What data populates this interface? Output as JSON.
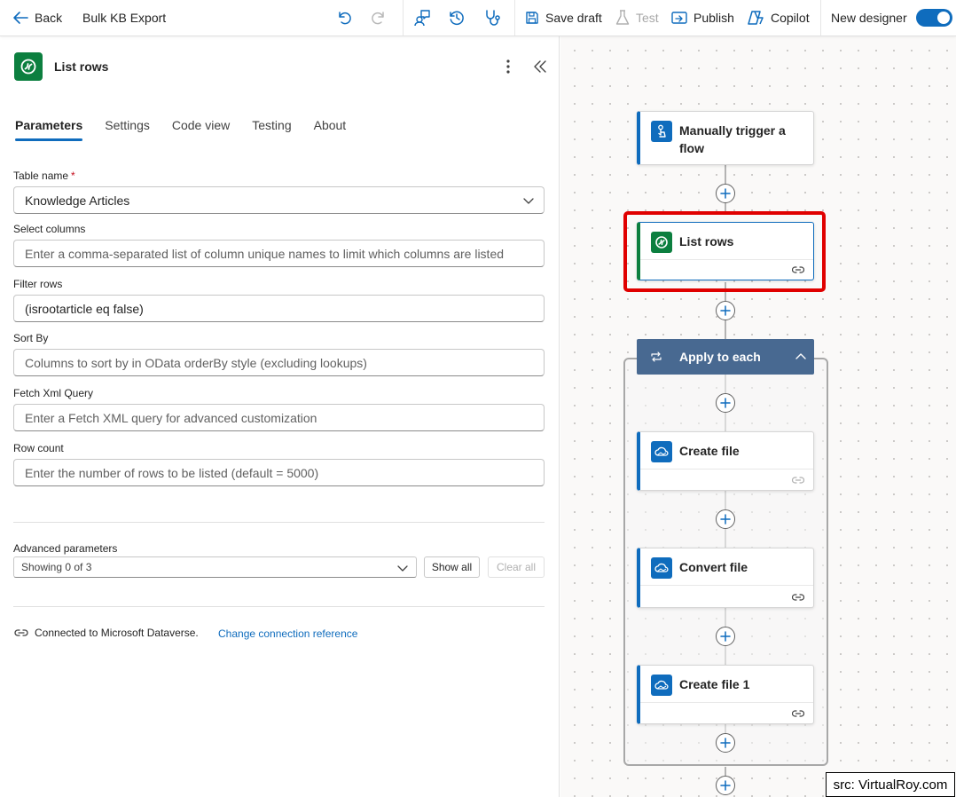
{
  "toolbar": {
    "back_label": "Back",
    "flow_name": "Bulk KB Export",
    "save_draft_label": "Save draft",
    "test_label": "Test",
    "publish_label": "Publish",
    "copilot_label": "Copilot",
    "new_designer_label": "New designer",
    "new_designer_on": true
  },
  "panel": {
    "title": "List rows",
    "tabs": [
      "Parameters",
      "Settings",
      "Code view",
      "Testing",
      "About"
    ],
    "active_tab": "Parameters",
    "fields": {
      "table_name": {
        "label": "Table name",
        "required_mark": "*",
        "value": "Knowledge Articles"
      },
      "select_columns": {
        "label": "Select columns",
        "placeholder": "Enter a comma-separated list of column unique names to limit which columns are listed"
      },
      "filter_rows": {
        "label": "Filter rows",
        "value": "(isrootarticle eq false)"
      },
      "sort_by": {
        "label": "Sort By",
        "placeholder": "Columns to sort by in OData orderBy style (excluding lookups)"
      },
      "fetch_xml": {
        "label": "Fetch Xml Query",
        "placeholder": "Enter a Fetch XML query for advanced customization"
      },
      "row_count": {
        "label": "Row count",
        "placeholder": "Enter the number of rows to be listed (default = 5000)"
      }
    },
    "advanced": {
      "label": "Advanced parameters",
      "selected": "Showing 0 of 3",
      "show_all_label": "Show all",
      "clear_all_label": "Clear all"
    },
    "connection": {
      "text": "Connected to Microsoft Dataverse.",
      "link": "Change connection reference"
    }
  },
  "canvas": {
    "nodes": {
      "trigger_line1": "Manually trigger a",
      "trigger_line2": "flow",
      "list_rows": "List rows",
      "apply_to_each": "Apply to each",
      "create_file": "Create file",
      "convert_file": "Convert file",
      "create_file_1": "Create file 1"
    }
  },
  "colors": {
    "accent": "#0f6cbd",
    "dataverse_green": "#0c7f3f",
    "apply_each_header": "#486991",
    "highlight_red": "#e00000"
  },
  "source_credit": "src: VirtualRoy.com"
}
